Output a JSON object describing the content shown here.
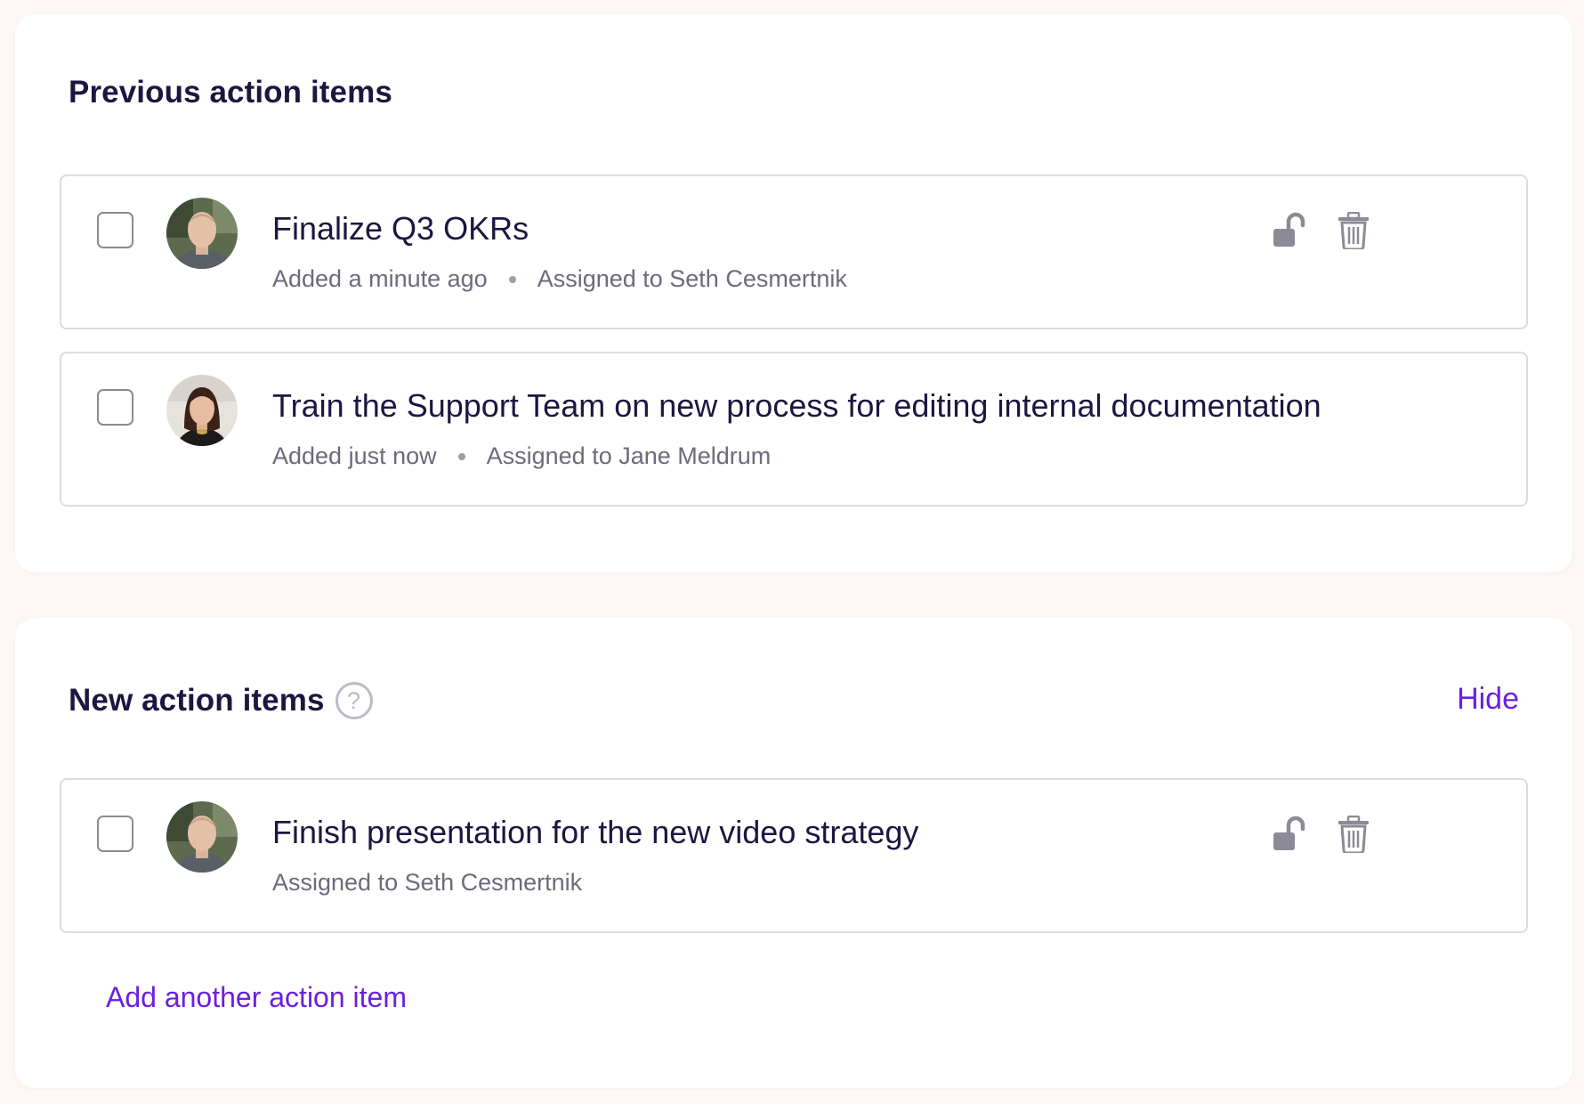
{
  "previous": {
    "title": "Previous action items",
    "items": [
      {
        "title": "Finalize Q3 OKRs",
        "added": "Added a minute ago",
        "assigned": "Assigned to Seth Cesmertnik",
        "avatar": "seth-avatar"
      },
      {
        "title": "Train the Support Team on new process for editing internal documentation",
        "added": "Added just now",
        "assigned": "Assigned to Jane Meldrum",
        "avatar": "jane-avatar"
      }
    ]
  },
  "new": {
    "title": "New action items",
    "help_icon": "?",
    "hide_label": "Hide",
    "items": [
      {
        "title": "Finish presentation for the new video strategy",
        "assigned": "Assigned to Seth Cesmertnik",
        "avatar": "seth-avatar"
      }
    ],
    "add_label": "Add another action item"
  },
  "colors": {
    "accent": "#6b1fe0",
    "text": "#1d1640",
    "muted": "#6d6a7c",
    "icon": "#8c8a96"
  }
}
